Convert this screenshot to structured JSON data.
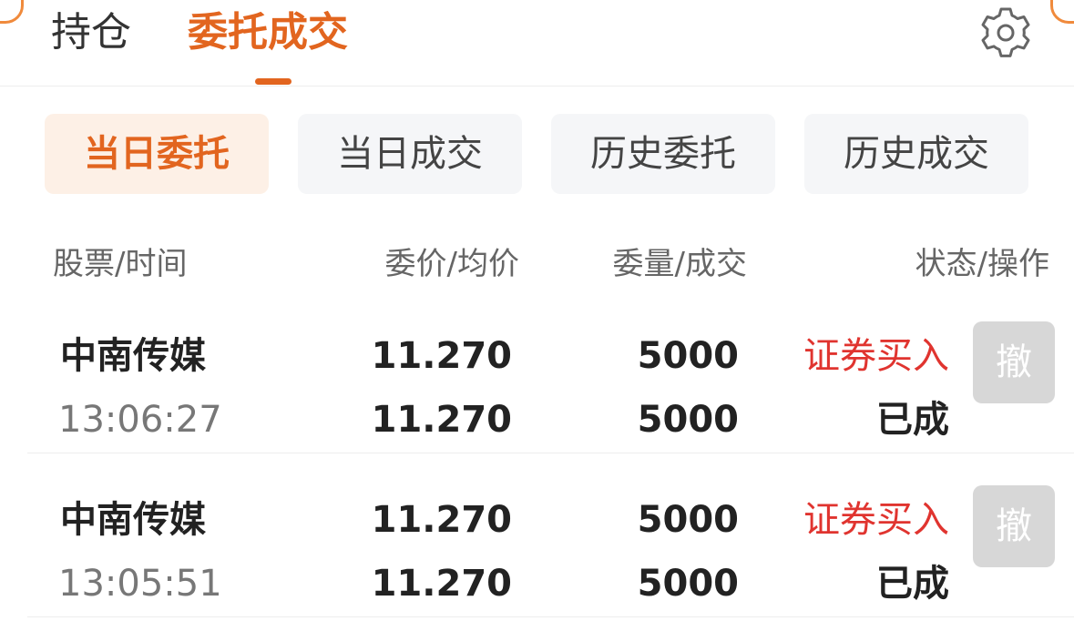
{
  "top_tabs": [
    {
      "label": "持仓"
    },
    {
      "label": "委托成交"
    }
  ],
  "settings_icon": "gear-icon",
  "segments": [
    {
      "label": "当日委托",
      "active": true
    },
    {
      "label": "当日成交",
      "active": false
    },
    {
      "label": "历史委托",
      "active": false
    },
    {
      "label": "历史成交",
      "active": false
    }
  ],
  "columns": {
    "col1": "股票/时间",
    "col2": "委价/均价",
    "col3": "委量/成交",
    "col4": "状态/操作"
  },
  "orders": [
    {
      "name": "中南传媒",
      "time": "13:06:27",
      "order_price": "11.270",
      "avg_price": "11.270",
      "order_qty": "5000",
      "filled_qty": "5000",
      "type": "证券买入",
      "status": "已成",
      "action": "撤"
    },
    {
      "name": "中南传媒",
      "time": "13:05:51",
      "order_price": "11.270",
      "avg_price": "11.270",
      "order_qty": "5000",
      "filled_qty": "5000",
      "type": "证券买入",
      "status": "已成",
      "action": "撤"
    }
  ],
  "colors": {
    "accent": "#e2651f",
    "buy": "#e0342f",
    "disabled_button": "#d7d7d7"
  }
}
